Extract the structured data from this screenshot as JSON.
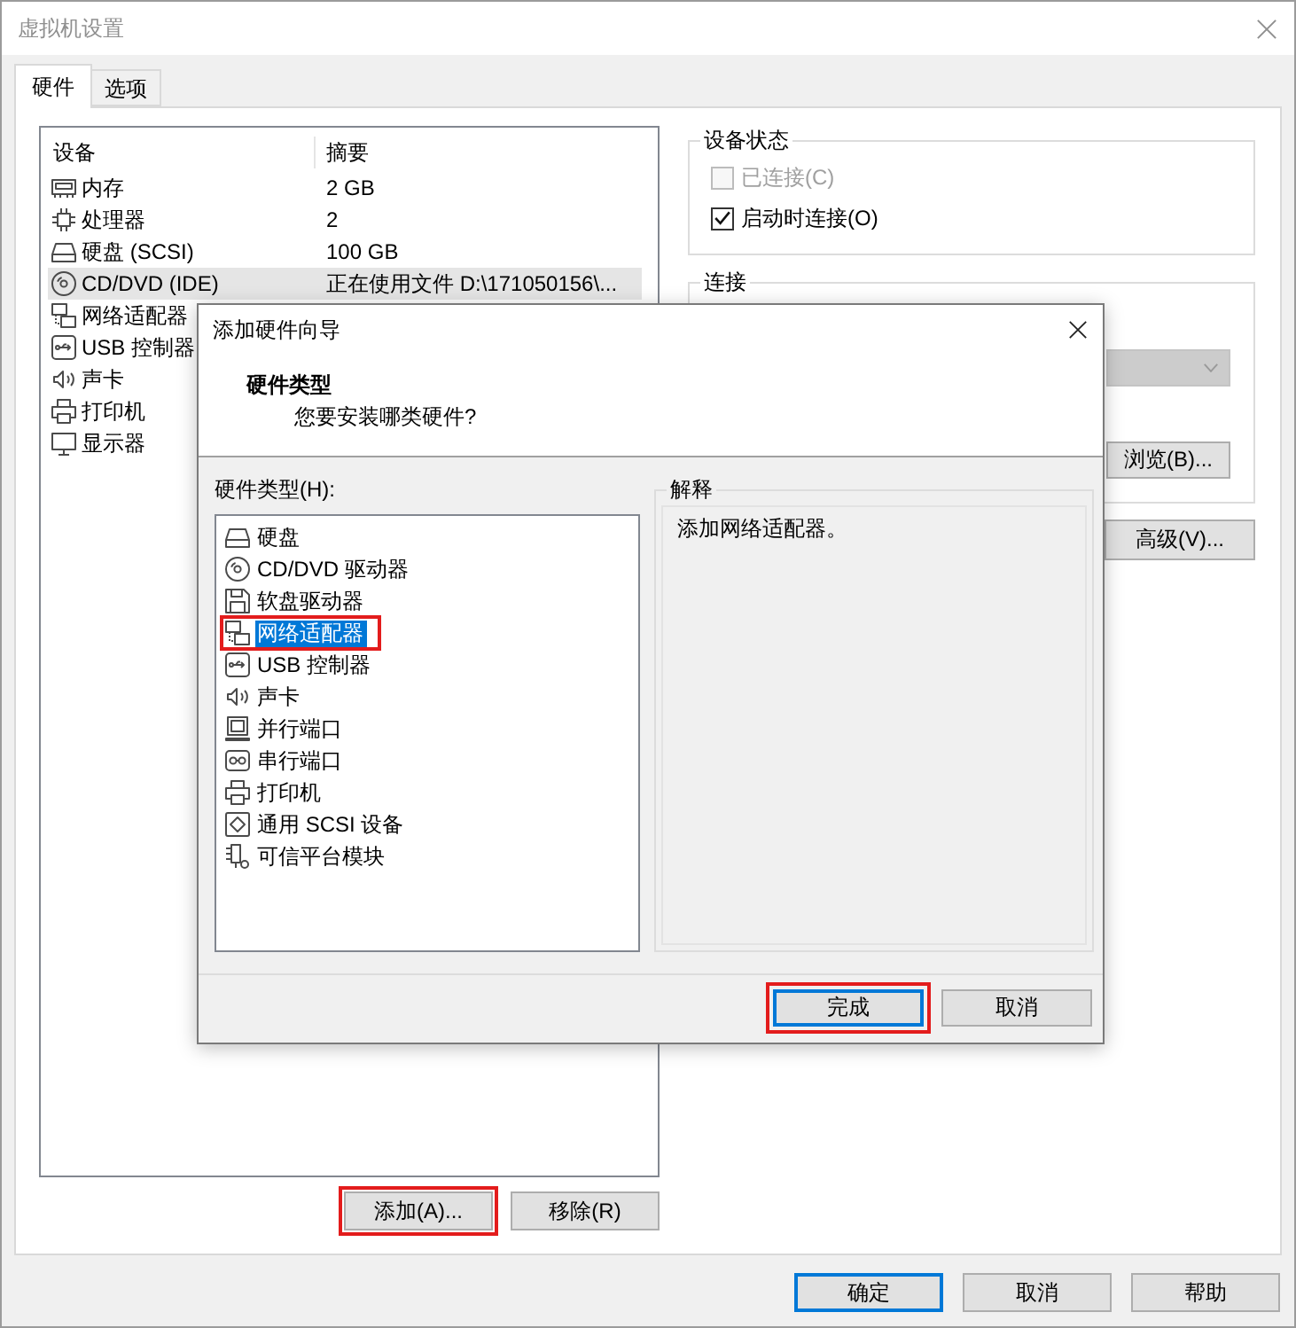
{
  "window": {
    "title": "虚拟机设置"
  },
  "tabs": [
    {
      "label": "硬件",
      "selected": true
    },
    {
      "label": "选项",
      "selected": false
    }
  ],
  "device_list": {
    "columns": [
      "设备",
      "摘要"
    ],
    "rows": [
      {
        "kind": "memory",
        "name": "内存",
        "summary": "2 GB",
        "selected": false
      },
      {
        "kind": "cpu",
        "name": "处理器",
        "summary": "2",
        "selected": false
      },
      {
        "kind": "disk",
        "name": "硬盘 (SCSI)",
        "summary": "100 GB",
        "selected": false
      },
      {
        "kind": "cdrom",
        "name": "CD/DVD (IDE)",
        "summary": "正在使用文件 D:\\171050156\\...",
        "selected": true
      },
      {
        "kind": "network",
        "name": "网络适配器",
        "selected": false
      },
      {
        "kind": "usb",
        "name": "USB 控制器",
        "selected": false
      },
      {
        "kind": "sound",
        "name": "声卡",
        "selected": false
      },
      {
        "kind": "printer",
        "name": "打印机",
        "selected": false
      },
      {
        "kind": "display",
        "name": "显示器",
        "selected": false
      }
    ]
  },
  "list_buttons": [
    {
      "label": "添加(A)...",
      "highlighted": true
    },
    {
      "label": "移除(R)",
      "highlighted": false
    }
  ],
  "device_status": {
    "title": "设备状态",
    "options": [
      {
        "label": "已连接(C)",
        "checked": false,
        "disabled": true
      },
      {
        "label": "启动时连接(O)",
        "checked": true,
        "disabled": false
      }
    ]
  },
  "connection": {
    "title": "连接",
    "dropdown": {
      "disabled": true
    },
    "browse_button": {
      "label": "浏览(B)..."
    }
  },
  "advanced_button": {
    "label": "高级(V)..."
  },
  "dialog_buttons": [
    {
      "label": "确定",
      "default": true
    },
    {
      "label": "取消",
      "default": false
    },
    {
      "label": "帮助",
      "default": false
    }
  ],
  "wizard": {
    "title": "添加硬件向导",
    "heading": "硬件类型",
    "subheading": "您要安装哪类硬件?",
    "list_label": "硬件类型(H):",
    "hardware_types": [
      {
        "kind": "disk",
        "label": "硬盘",
        "selected": false,
        "highlighted": false
      },
      {
        "kind": "cdrom",
        "label": "CD/DVD 驱动器",
        "selected": false,
        "highlighted": false
      },
      {
        "kind": "floppy",
        "label": "软盘驱动器",
        "selected": false,
        "highlighted": false
      },
      {
        "kind": "network",
        "label": "网络适配器",
        "selected": true,
        "highlighted": true
      },
      {
        "kind": "usb",
        "label": "USB 控制器",
        "selected": false,
        "highlighted": false
      },
      {
        "kind": "sound",
        "label": "声卡",
        "selected": false,
        "highlighted": false
      },
      {
        "kind": "parallel",
        "label": "并行端口",
        "selected": false,
        "highlighted": false
      },
      {
        "kind": "serial",
        "label": "串行端口",
        "selected": false,
        "highlighted": false
      },
      {
        "kind": "printer",
        "label": "打印机",
        "selected": false,
        "highlighted": false
      },
      {
        "kind": "scsi",
        "label": "通用 SCSI 设备",
        "selected": false,
        "highlighted": false
      },
      {
        "kind": "tpm",
        "label": "可信平台模块",
        "selected": false,
        "highlighted": false
      }
    ],
    "explanation": {
      "title": "解释",
      "text": "添加网络适配器。"
    },
    "buttons": [
      {
        "label": "完成",
        "default": true,
        "highlighted": true
      },
      {
        "label": "取消",
        "default": false,
        "highlighted": false
      }
    ]
  }
}
